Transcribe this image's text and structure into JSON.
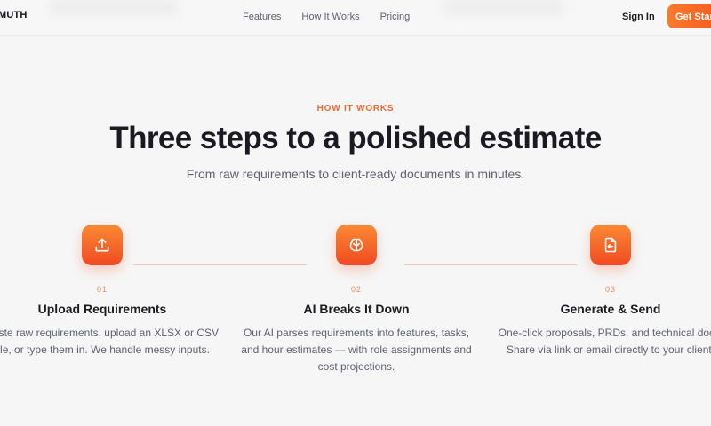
{
  "header": {
    "brand": "MUTH",
    "nav": [
      "Features",
      "How It Works",
      "Pricing"
    ],
    "signin": "Sign In",
    "cta": "Get Started"
  },
  "hero": {
    "eyebrow": "HOW IT WORKS",
    "title": "Three steps to a polished estimate",
    "subtitle": "From raw requirements to client-ready documents in minutes."
  },
  "steps": [
    {
      "icon": "upload-icon",
      "num": "01",
      "title": "Upload Requirements",
      "desc": "Paste raw requirements, upload an XLSX or CSV file, or type them in. We handle messy inputs."
    },
    {
      "icon": "brain-icon",
      "num": "02",
      "title": "AI Breaks It Down",
      "desc": "Our AI parses requirements into features, tasks, and hour estimates — with role assignments and cost projections."
    },
    {
      "icon": "document-send-icon",
      "num": "03",
      "title": "Generate & Send",
      "desc": "One-click proposals, PRDs, and technical docs. Share via link or email directly to your client."
    }
  ],
  "colors": {
    "accent": "#f26b2a",
    "accent_gradient_top": "#fb8a33",
    "accent_gradient_bottom": "#f04a22",
    "connector": "#f3c5b3",
    "background": "#f6f6f7"
  }
}
